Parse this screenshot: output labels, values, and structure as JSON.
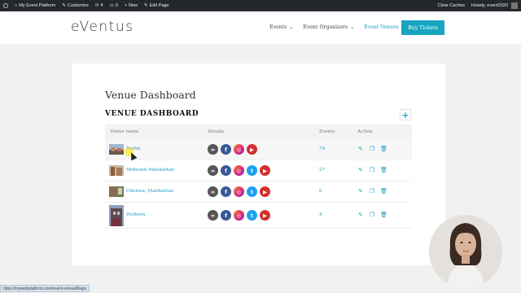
{
  "adminbar": {
    "site": "My Event Platform",
    "customize": "Customize",
    "updates": "4",
    "comments": "0",
    "new": "New",
    "edit": "Edit Page",
    "clear_caches": "Clear Caches",
    "howdy": "Howdy, event2020"
  },
  "header": {
    "logo": "eVentus",
    "nav": [
      {
        "label": "Events"
      },
      {
        "label": "Event Organizers"
      },
      {
        "label": "Event Venues"
      }
    ],
    "buy_tickets": "Buy Tickets"
  },
  "main": {
    "page_title": "Venue Dashboard",
    "dashboard_title": "VENUE DASHBOARD",
    "add_label": "+",
    "columns": {
      "name": "Venue name",
      "details": "Details",
      "events": "Events",
      "action": "Action"
    },
    "rows": [
      {
        "name": "Berlin",
        "events": "74"
      },
      {
        "name": "Midtown Manhattan",
        "events": "27"
      },
      {
        "name": "Chelsea, Manhattan",
        "events": "0"
      },
      {
        "name": "Holborn",
        "events": "4"
      }
    ]
  },
  "status_url": "https://mywebplatform.com/event-venue/8/aps",
  "colors": {
    "accent": "#17a5c0",
    "adminbar": "#23282d",
    "link": "#1a9cc4"
  },
  "icons": [
    "link-icon",
    "facebook-icon",
    "instagram-icon",
    "twitter-icon",
    "youtube-icon",
    "edit-icon",
    "duplicate-icon",
    "trash-icon"
  ]
}
